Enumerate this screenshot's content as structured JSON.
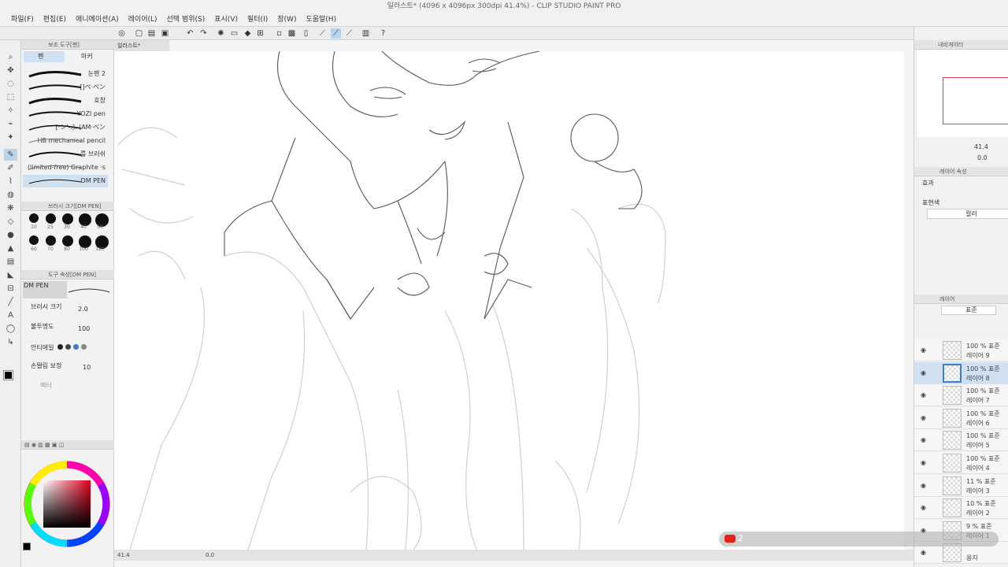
{
  "window": {
    "title": "일러스트* (4096 x 4096px 300dpi 41.4%) - CLIP STUDIO PAINT PRO"
  },
  "menu": [
    "파일(F)",
    "편집(E)",
    "애니메이션(A)",
    "레이어(L)",
    "선택 범위(S)",
    "표시(V)",
    "필터(I)",
    "창(W)",
    "도움말(H)"
  ],
  "sub_tool": {
    "header": "보조 도구[펜]",
    "tab_pen": "펜",
    "tab_marker": "마커",
    "brushes": [
      "눈펜 2",
      "[]ペ·ベン",
      "호창",
      "YOZI pen",
      "[·ン'-ふ (AM·ベン",
      "HB mechanical pencil",
      "를 브러쉬",
      "(limited-free) Graphite ·s",
      "DM PEN"
    ]
  },
  "brush_size": {
    "header": "브러시 크기[DM PEN]",
    "sizes": [
      "20",
      "25",
      "30",
      "40",
      "50",
      "60",
      "70",
      "80",
      "100",
      "120"
    ]
  },
  "tool_property": {
    "header": "도구 속성[DM PEN]",
    "brush_name": "DM PEN",
    "size_label": "브러시 크기",
    "size_value": "2.0",
    "opacity_label": "불투명도",
    "opacity_value": "100",
    "aa_label": "안티에일",
    "stab_label": "손떨림 보정",
    "stab_value": "10",
    "vector_label": "벡터"
  },
  "canvas": {
    "tab": "일러스트*",
    "zoom": "41.4",
    "angle": "0.0"
  },
  "navigator": {
    "header": "내비게이터",
    "zoom": "41.4",
    "angle": "0.0"
  },
  "layer_property": {
    "header": "레이어 속성",
    "effect_label": "효과",
    "expression_label": "표현색",
    "expression_value": "컬러"
  },
  "layer_panel": {
    "header": "레이어",
    "blend_mode": "표준"
  },
  "layers": [
    {
      "opacity": "100 %",
      "blend": "표준",
      "name": "레이어 9",
      "selected": false
    },
    {
      "opacity": "100 %",
      "blend": "표준",
      "name": "레이어 8",
      "selected": true
    },
    {
      "opacity": "100 %",
      "blend": "표준",
      "name": "레이어 7",
      "selected": false
    },
    {
      "opacity": "100 %",
      "blend": "표준",
      "name": "레이어 6",
      "selected": false
    },
    {
      "opacity": "100 %",
      "blend": "표준",
      "name": "레이어 5",
      "selected": false
    },
    {
      "opacity": "100 %",
      "blend": "표준",
      "name": "레이어 4",
      "selected": false
    },
    {
      "opacity": "11 %",
      "blend": "표준",
      "name": "레이어 3",
      "selected": false
    },
    {
      "opacity": "10 %",
      "blend": "표준",
      "name": "레이어 2",
      "selected": false
    },
    {
      "opacity": "9 %",
      "blend": "표준",
      "name": "레이어 1",
      "selected": false
    },
    {
      "opacity": "",
      "blend": "",
      "name": "용지",
      "selected": false
    }
  ],
  "overlay": {
    "count": "2"
  },
  "colors": {
    "accent": "#3d7ec7",
    "main_color": "#000000"
  }
}
